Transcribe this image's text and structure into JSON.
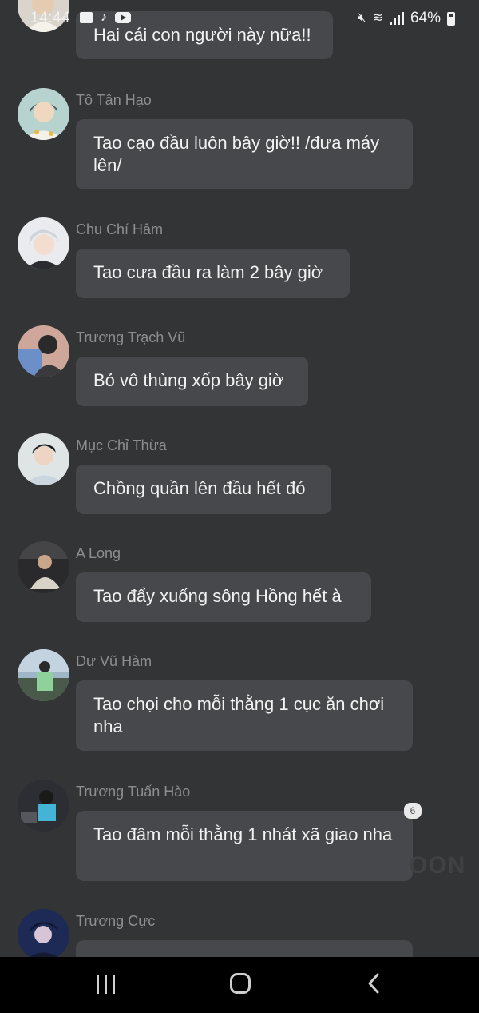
{
  "status_bar": {
    "time": "14:44",
    "battery": "64%",
    "left_icons": [
      "gallery-icon",
      "tiktok-icon",
      "youtube-icon"
    ],
    "right_icons": [
      "mute-icon",
      "wifi-icon",
      "signal-icon",
      "battery-icon"
    ]
  },
  "messages": [
    {
      "sender": "",
      "text": "Hai cái con người này nữa!!"
    },
    {
      "sender": "Tô Tân Hạo",
      "text": "Tao cạo đầu luôn bây giờ!! /đưa máy lên/"
    },
    {
      "sender": "Chu Chí Hâm",
      "text": "Tao cưa đầu ra làm 2 bây giờ"
    },
    {
      "sender": "Trương Trạch Vũ",
      "text": "Bỏ vô thùng xốp bây giờ"
    },
    {
      "sender": "Mục Chỉ Thừa",
      "text": "Chồng quần lên đầu hết đó"
    },
    {
      "sender": "A Long",
      "text": "Tao đẩy xuống sông Hồng hết à"
    },
    {
      "sender": "Dư Vũ Hàm",
      "text": "Tao chọi cho mỗi thằng 1 cục ăn chơi nha"
    },
    {
      "sender": "Trương Tuấn Hào",
      "text": "Tao đâm mỗi thằng 1 nhát xã giao nha"
    },
    {
      "sender": "Trương Cực",
      "text": ""
    }
  ],
  "badge": "6",
  "watermark": "OON",
  "colors": {
    "background": "#333436",
    "bubble": "#47484b",
    "sender": "#8d8e91",
    "nav_bar": "#000000"
  },
  "nav_bar": {
    "buttons": [
      "recent-apps-icon",
      "home-icon",
      "back-icon"
    ]
  }
}
